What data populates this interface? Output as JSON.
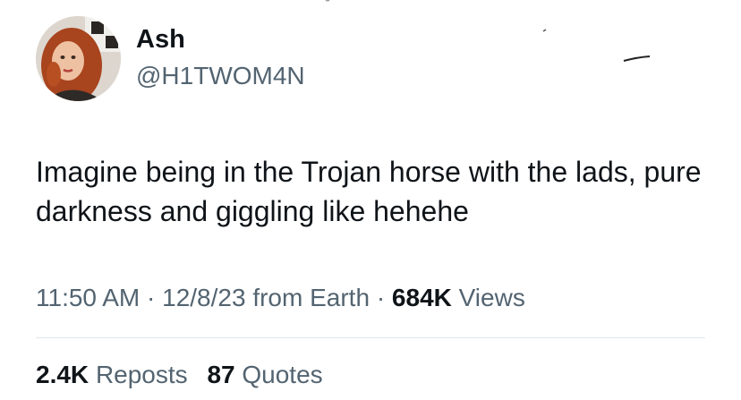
{
  "user": {
    "display_name": "Ash",
    "handle": "@H1TWOM4N"
  },
  "tweet": {
    "text": "Imagine being in the Trojan horse with the lads, pure darkness and giggling like hehehe",
    "time": "11:50 AM",
    "separator": "·",
    "date": "12/8/23 from Earth",
    "views_count": "684K",
    "views_label": "Views"
  },
  "stats": {
    "reposts_count": "2.4K",
    "reposts_label": "Reposts",
    "quotes_count": "87",
    "quotes_label": "Quotes"
  },
  "colors": {
    "text_primary": "#0f1419",
    "text_secondary": "#536471",
    "divider": "#e1e6ea"
  },
  "icons": {
    "avatar": "profile-photo"
  }
}
